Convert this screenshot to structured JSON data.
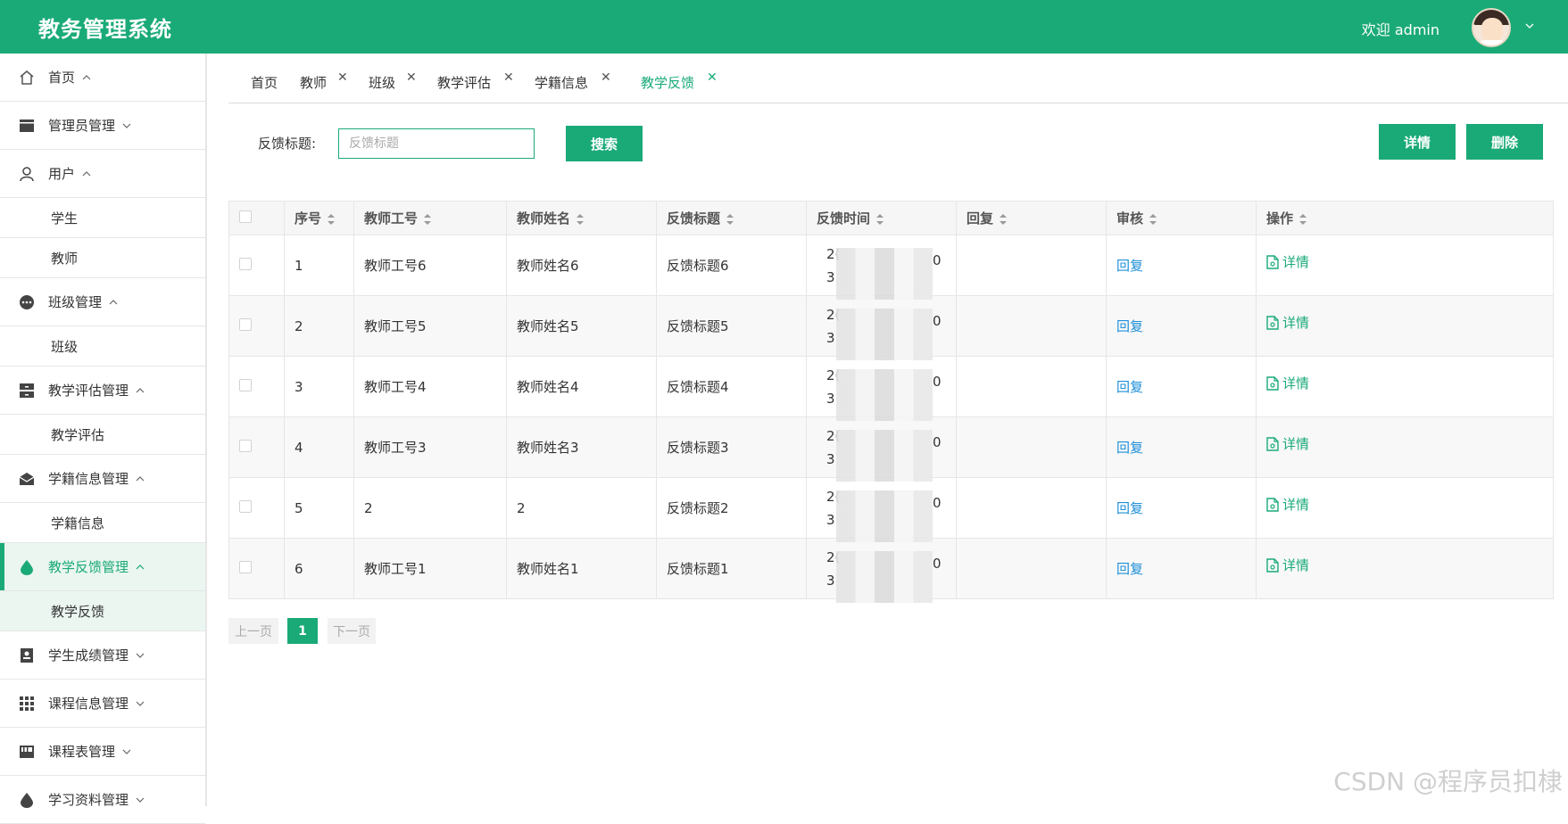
{
  "header": {
    "title": "教务管理系统",
    "welcome": "欢迎 admin",
    "avatar_icon": "user-avatar",
    "brand_color": "#1aaa78"
  },
  "sidebar": {
    "items": [
      {
        "label": "首页",
        "icon": "home-icon",
        "arrow": "up"
      },
      {
        "label": "管理员管理",
        "icon": "admin-card-icon",
        "arrow": "down"
      },
      {
        "label": "用户",
        "icon": "user-icon",
        "arrow": "up",
        "children": [
          "学生",
          "教师"
        ]
      },
      {
        "label": "班级管理",
        "icon": "class-icon",
        "arrow": "up",
        "children": [
          "班级"
        ]
      },
      {
        "label": "教学评估管理",
        "icon": "evaluation-icon",
        "arrow": "up",
        "children": [
          "教学评估"
        ]
      },
      {
        "label": "学籍信息管理",
        "icon": "mail-icon",
        "arrow": "up",
        "children": [
          "学籍信息"
        ]
      },
      {
        "label": "教学反馈管理",
        "icon": "drop-icon",
        "arrow": "up",
        "active": true,
        "children": [
          "教学反馈"
        ]
      },
      {
        "label": "学生成绩管理",
        "icon": "grade-icon",
        "arrow": "down"
      },
      {
        "label": "课程信息管理",
        "icon": "grid-icon",
        "arrow": "down"
      },
      {
        "label": "课程表管理",
        "icon": "schedule-icon",
        "arrow": "down"
      },
      {
        "label": "学习资料管理",
        "icon": "drop-icon",
        "arrow": "down"
      }
    ]
  },
  "tabs": [
    "首页",
    "教师",
    "班级",
    "教学评估",
    "学籍信息",
    "教学反馈"
  ],
  "active_tab": "教学反馈",
  "search": {
    "label": "反馈标题:",
    "placeholder": "反馈标题",
    "value": "",
    "button": "搜索"
  },
  "actions": {
    "detail": "详情",
    "delete": "删除"
  },
  "table": {
    "columns": [
      "序号",
      "教师工号",
      "教师姓名",
      "反馈标题",
      "反馈时间",
      "回复",
      "审核",
      "操作"
    ],
    "rows": [
      {
        "no": "1",
        "teacher_id": "教师工号6",
        "teacher_name": "教师姓名6",
        "title": "反馈标题6",
        "time_start": "2(",
        "time_end": "0",
        "time_line2": "3",
        "reply": "",
        "audit": "回复",
        "op": "详情"
      },
      {
        "no": "2",
        "teacher_id": "教师工号5",
        "teacher_name": "教师姓名5",
        "title": "反馈标题5",
        "time_start": "2(",
        "time_end": "0",
        "time_line2": "3",
        "reply": "",
        "audit": "回复",
        "op": "详情"
      },
      {
        "no": "3",
        "teacher_id": "教师工号4",
        "teacher_name": "教师姓名4",
        "title": "反馈标题4",
        "time_start": "2(",
        "time_end": "0",
        "time_line2": "3",
        "reply": "",
        "audit": "回复",
        "op": "详情"
      },
      {
        "no": "4",
        "teacher_id": "教师工号3",
        "teacher_name": "教师姓名3",
        "title": "反馈标题3",
        "time_start": "2(",
        "time_end": "0",
        "time_line2": "3",
        "reply": "",
        "audit": "回复",
        "op": "详情"
      },
      {
        "no": "5",
        "teacher_id": "2",
        "teacher_name": "2",
        "title": "反馈标题2",
        "time_start": "2(",
        "time_end": "0",
        "time_line2": "3",
        "reply": "",
        "audit": "回复",
        "op": "详情"
      },
      {
        "no": "6",
        "teacher_id": "教师工号1",
        "teacher_name": "教师姓名1",
        "title": "反馈标题1",
        "time_start": "2(",
        "time_end": "0",
        "time_line2": "3",
        "reply": "",
        "audit": "回复",
        "op": "详情"
      }
    ]
  },
  "pagination": {
    "prev": "上一页",
    "current": "1",
    "next": "下一页"
  },
  "watermark": "CSDN @程序员扣棣"
}
